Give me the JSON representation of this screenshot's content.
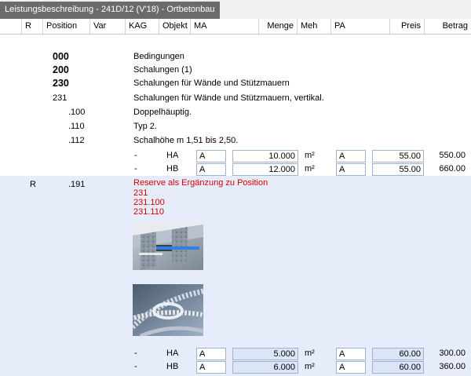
{
  "tab": {
    "title": "Leistungsbeschreibung - 241D/12 (V'18) - Ortbetonbau"
  },
  "columns": {
    "r": "R",
    "position": "Position",
    "var": "Var",
    "kag": "KAG",
    "objekt": "Objekt",
    "ma": "MA",
    "menge": "Menge",
    "meh": "Meh",
    "pa": "PA",
    "preis": "Preis",
    "betrag": "Betrag"
  },
  "rows": {
    "r0": {
      "pos": "000",
      "text": "Bedingungen"
    },
    "r1": {
      "pos": "200",
      "text": "Schalungen (1)"
    },
    "r2": {
      "pos": "230",
      "text": "Schalungen für Wände und Stützmauern"
    },
    "r3": {
      "pos": "231",
      "text": "Schalungen für Wände und Stützmauern, vertikal."
    },
    "r4": {
      "pos": ".100",
      "text": "Doppelhäuptig."
    },
    "r5": {
      "pos": ".110",
      "text": "Typ 2."
    },
    "r6": {
      "pos": ".112",
      "text": "Schalhöhe m 1,51 bis 2,50."
    }
  },
  "qty": {
    "q1": {
      "dash": "-",
      "objekt": "HA",
      "ma": "A",
      "menge": "10.000",
      "meh": "m²",
      "pa": "A",
      "preis": "55.00",
      "betrag": "550.00"
    },
    "q2": {
      "dash": "-",
      "objekt": "HB",
      "ma": "A",
      "menge": "12.000",
      "meh": "m²",
      "pa": "A",
      "preis": "55.00",
      "betrag": "660.00"
    },
    "q3": {
      "dash": "-",
      "objekt": "HA",
      "ma": "A",
      "menge": "5.000",
      "meh": "m²",
      "pa": "A",
      "preis": "60.00",
      "betrag": "300.00"
    },
    "q4": {
      "dash": "-",
      "objekt": "HB",
      "ma": "A",
      "menge": "6.000",
      "meh": "m²",
      "pa": "A",
      "preis": "60.00",
      "betrag": "360.00"
    }
  },
  "reserve": {
    "r": "R",
    "pos": ".191",
    "lines": [
      "Reserve als Ergänzung zu Position",
      "231",
      "231.100",
      "231.110"
    ]
  },
  "colors": {
    "tab": "#6b6b6b",
    "reserve_bg": "#e6ecfa",
    "reserve_text": "#d40000",
    "field_border": "#9fb2d2"
  }
}
